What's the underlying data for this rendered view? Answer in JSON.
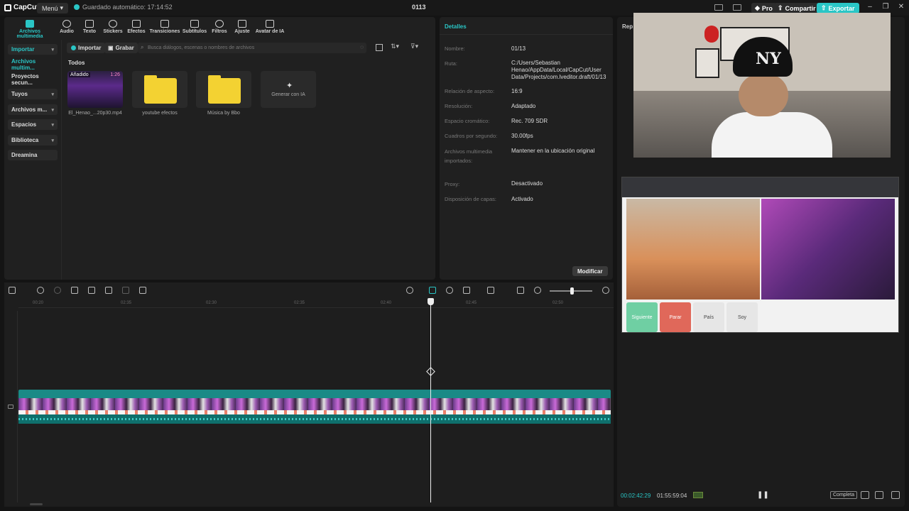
{
  "titlebar": {
    "app_name": "CapCut",
    "menu_label": "Menú",
    "autosave": "Guardado automático: 17:14:52",
    "project_title": "0113",
    "pro_label": "Pro",
    "share_label": "Compartir",
    "export_label": "Exportar"
  },
  "toolbar": {
    "items": [
      {
        "label": "Archivos multimedia",
        "icon": "media-icon"
      },
      {
        "label": "Audio",
        "icon": "audio-icon"
      },
      {
        "label": "Texto",
        "icon": "text-icon"
      },
      {
        "label": "Stickers",
        "icon": "sticker-icon"
      },
      {
        "label": "Efectos",
        "icon": "effects-icon"
      },
      {
        "label": "Transiciones",
        "icon": "transitions-icon"
      },
      {
        "label": "Subtítulos",
        "icon": "subtitles-icon"
      },
      {
        "label": "Filtros",
        "icon": "filters-icon"
      },
      {
        "label": "Ajuste",
        "icon": "adjust-icon"
      },
      {
        "label": "Avatar de IA",
        "icon": "avatar-icon"
      }
    ]
  },
  "sidebar": {
    "items": [
      {
        "label": "Importar"
      },
      {
        "label": "Archivos multim..."
      },
      {
        "label": "Proyectos secun..."
      },
      {
        "label": "Tuyos"
      },
      {
        "label": "Archivos m..."
      },
      {
        "label": "Espacios"
      },
      {
        "label": "Biblioteca"
      },
      {
        "label": "Dreamina"
      }
    ]
  },
  "media": {
    "import_label": "Importar",
    "record_label": "Grabar",
    "search_placeholder": "Busca diálogos, escenas o nombres de archivos",
    "section_label": "Todos",
    "items": [
      {
        "label": "El_Henao_...20p30.mp4",
        "badge": "Añadido",
        "duration": "1:26"
      },
      {
        "label": "youtube efectos"
      },
      {
        "label": "Música by Bbo"
      },
      {
        "label": "Generar con IA"
      }
    ]
  },
  "details": {
    "title": "Detalles",
    "rows": [
      {
        "label": "Nombre:",
        "value": "01/13"
      },
      {
        "label": "Ruta:",
        "value": "C:/Users/Sebastian Henao/AppData/Local/CapCut/User Data/Projects/com.lveditor.draft/01/13"
      },
      {
        "label": "Relación de aspecto:",
        "value": "16:9"
      },
      {
        "label": "Resolución:",
        "value": "Adaptado"
      },
      {
        "label": "Espacio cromático:",
        "value": "Rec. 709 SDR"
      },
      {
        "label": "Cuadros por segundo:",
        "value": "30.00fps"
      },
      {
        "label": "Archivos multimedia importados:",
        "value": "Mantener en la ubicación original"
      },
      {
        "label": "Proxy:",
        "value": "Desactivado"
      },
      {
        "label": "Disposición de capas:",
        "value": "Activado"
      }
    ],
    "modify_label": "Modificar"
  },
  "player": {
    "header": "Rep",
    "current_time": "00:02:42:29",
    "total_time": "01:55:59:04",
    "complete_label": "Completa",
    "cap_text": "NY",
    "browser_buttons": [
      "Siguiente",
      "Parar",
      "País",
      "Soy"
    ]
  },
  "timeline": {
    "ticks": [
      "00:20",
      "02:35",
      "02:30",
      "02:35",
      "02:40",
      "02:45",
      "02:50"
    ]
  },
  "colors": {
    "accent": "#2ac6c6",
    "background": "#141414",
    "panel": "#202020"
  }
}
